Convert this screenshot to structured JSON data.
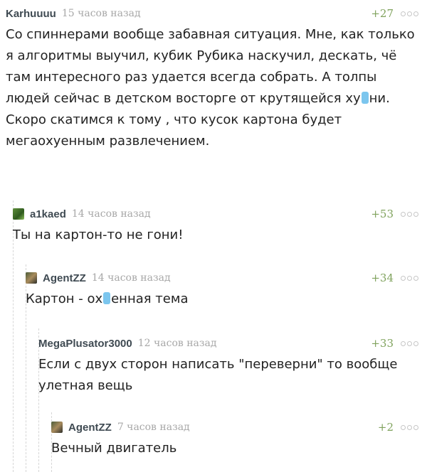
{
  "comments": [
    {
      "user": "Karhuuuu",
      "time": "15 часов назад",
      "rating": "+27",
      "text_a": "Со спиннерами вообще забавная ситуация. Мне, как только я алгоритмы выучил, кубик Рубика наскучил, дескать, чё там интересного раз удается всегда собрать. А толпы людей сейчас в детском восторге от крутящейся ху",
      "text_b": "ни.\nСкоро скатимся к тому , что кусок картона будет мегаохуенным развлечением."
    },
    {
      "user": "a1kaed",
      "time": "14 часов назад",
      "rating": "+53",
      "text": "Ты на картон-то не гони!"
    },
    {
      "user": "AgentZZ",
      "time": "14 часов назад",
      "rating": "+34",
      "text_a": "Картон - ох",
      "text_b": "енная тема"
    },
    {
      "user": "MegaPlusator3000",
      "time": "12 часов назад",
      "rating": "+33",
      "text": "Если с двух сторон написать \"переверни\" то вообще улетная вещь"
    },
    {
      "user": "AgentZZ",
      "time": "7 часов назад",
      "rating": "+2",
      "text": "Вечный двигатель"
    }
  ]
}
